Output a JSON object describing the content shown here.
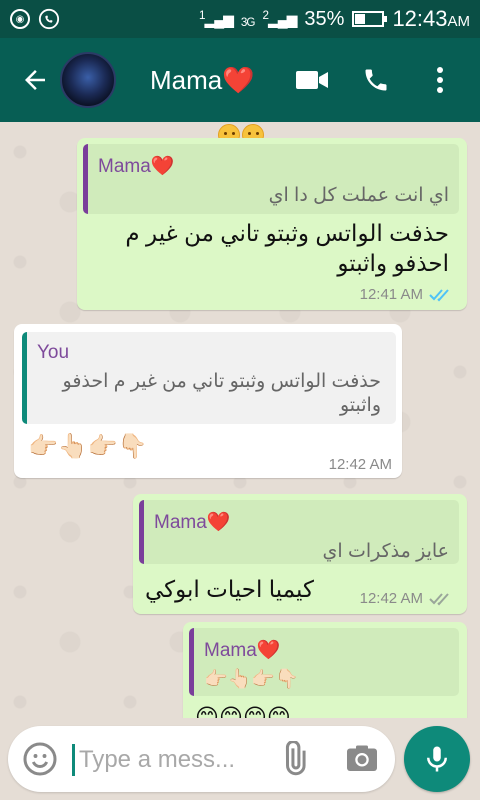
{
  "status_bar": {
    "battery": "35%",
    "time": "12:43",
    "ampm": "AM",
    "network": "3G",
    "sim1": "1",
    "sim2": "2"
  },
  "header": {
    "contact_name": "Mama",
    "heart": "❤️"
  },
  "messages": [
    {
      "direction": "out",
      "quote_name": "Mama",
      "quote_heart": "❤️",
      "quote_text": "اي انت عملت كل دا اي",
      "text": "حذفت الواتس وثبتو تاني من غير م احذفو واثبتو",
      "time": "12:41 AM",
      "status": "read"
    },
    {
      "direction": "in",
      "quote_name": "You",
      "quote_text": "حذفت الواتس وثبتو تاني من غير م احذفو واثبتو",
      "text": "👉🏻👆🏻👉🏻👇🏻",
      "time": "12:42 AM"
    },
    {
      "direction": "out",
      "quote_name": "Mama",
      "quote_heart": "❤️",
      "quote_text": "عايز مذكرات اي",
      "text": "كيميا احيات ابوكي",
      "time": "12:42 AM",
      "status": "delivered"
    },
    {
      "direction": "out",
      "quote_name": "Mama",
      "quote_heart": "❤️",
      "quote_text": "👉🏻👆🏻👉🏻👇🏻",
      "text": "😊😊😊😊"
    }
  ],
  "top_emoji": "😊😊",
  "input": {
    "placeholder": "Type a mess..."
  },
  "colors": {
    "header": "#075e54",
    "statusbar": "#0a4f45",
    "outgoing": "#dcf8c6",
    "incoming": "#ffffff",
    "accent": "#0e8a7a",
    "read_ticks": "#4fc3f7"
  }
}
